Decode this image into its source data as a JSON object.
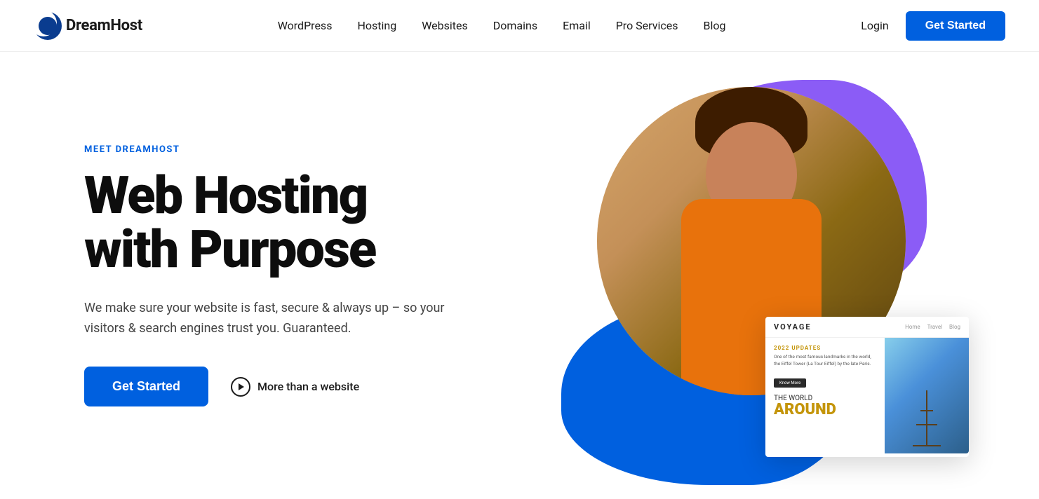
{
  "brand": {
    "name": "DreamHost",
    "logo_alt": "DreamHost logo"
  },
  "nav": {
    "links": [
      {
        "id": "wordpress",
        "label": "WordPress"
      },
      {
        "id": "hosting",
        "label": "Hosting"
      },
      {
        "id": "websites",
        "label": "Websites"
      },
      {
        "id": "domains",
        "label": "Domains"
      },
      {
        "id": "email",
        "label": "Email"
      },
      {
        "id": "pro-services",
        "label": "Pro Services"
      },
      {
        "id": "blog",
        "label": "Blog"
      }
    ],
    "login_label": "Login",
    "cta_label": "Get Started"
  },
  "hero": {
    "eyebrow": "MEET DREAMHOST",
    "title_line1": "Web Hosting",
    "title_line2": "with Purpose",
    "description": "We make sure your website is fast, secure & always up – so your visitors & search engines trust you. Guaranteed.",
    "cta_label": "Get Started",
    "secondary_label": "More than a website"
  },
  "website_card": {
    "logo": "VOYAGE",
    "nav_items": [
      "Home",
      "Travel",
      "Blog"
    ],
    "update_label": "2022 UPDATES",
    "body_text": "One of the most famous landmarks in the world, the Eiffel Tower (La Tour Eiffel) by the late Paris.",
    "know_more": "Know More",
    "world_the": "THE WORLD",
    "world_around": "AROUND"
  }
}
